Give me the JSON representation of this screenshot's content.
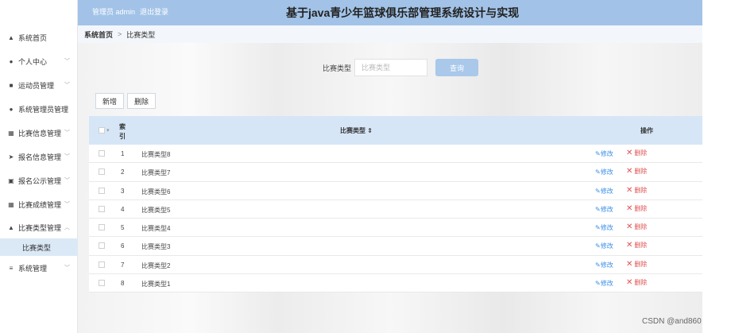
{
  "header": {
    "admin_label": "管理员 admin",
    "logout_label": "退出登录",
    "title": "基于java青少年篮球俱乐部管理系统设计与实现"
  },
  "sidebar": {
    "items": [
      {
        "label": "系统首页",
        "icon": "home-icon",
        "chevron": false
      },
      {
        "label": "个人中心",
        "icon": "user-icon",
        "chevron": true
      },
      {
        "label": "运动员管理",
        "icon": "briefcase-icon",
        "chevron": true
      },
      {
        "label": "系统管理员管理",
        "icon": "user-icon",
        "chevron": true
      },
      {
        "label": "比赛信息管理",
        "icon": "grid-icon",
        "chevron": true
      },
      {
        "label": "报名信息管理",
        "icon": "send-icon",
        "chevron": true
      },
      {
        "label": "报名公示管理",
        "icon": "clipboard-icon",
        "chevron": true
      },
      {
        "label": "比赛成绩管理",
        "icon": "grid-icon",
        "chevron": true
      },
      {
        "label": "比赛类型管理",
        "icon": "thumbs-up-icon",
        "chevron": true,
        "expanded": true
      },
      {
        "label": "系统管理",
        "icon": "menu-icon",
        "chevron": true
      }
    ],
    "sub_item": "比赛类型"
  },
  "breadcrumb": {
    "home": "系统首页",
    "separator": ">",
    "current": "比赛类型"
  },
  "search": {
    "label": "比赛类型",
    "placeholder": "比赛类型",
    "button": "查询"
  },
  "toolbar": {
    "add_label": "新增",
    "delete_label": "删除"
  },
  "table": {
    "col_index_line1": "索",
    "col_index_line2": "引",
    "col_type": "比赛类型 ⇕",
    "col_ops": "操作",
    "edit_label": "修改",
    "delete_label": "删除",
    "rows": [
      {
        "index": "1",
        "name": "比赛类型8"
      },
      {
        "index": "2",
        "name": "比赛类型7"
      },
      {
        "index": "3",
        "name": "比赛类型6"
      },
      {
        "index": "4",
        "name": "比赛类型5"
      },
      {
        "index": "5",
        "name": "比赛类型4"
      },
      {
        "index": "6",
        "name": "比赛类型3"
      },
      {
        "index": "7",
        "name": "比赛类型2"
      },
      {
        "index": "8",
        "name": "比赛类型1"
      }
    ]
  },
  "watermark": "CSDN @and860",
  "colors": {
    "header_bg": "#a2c3e7",
    "accent": "#3a8ee6",
    "danger": "#e05050",
    "table_header_bg": "#d6e6f7"
  }
}
